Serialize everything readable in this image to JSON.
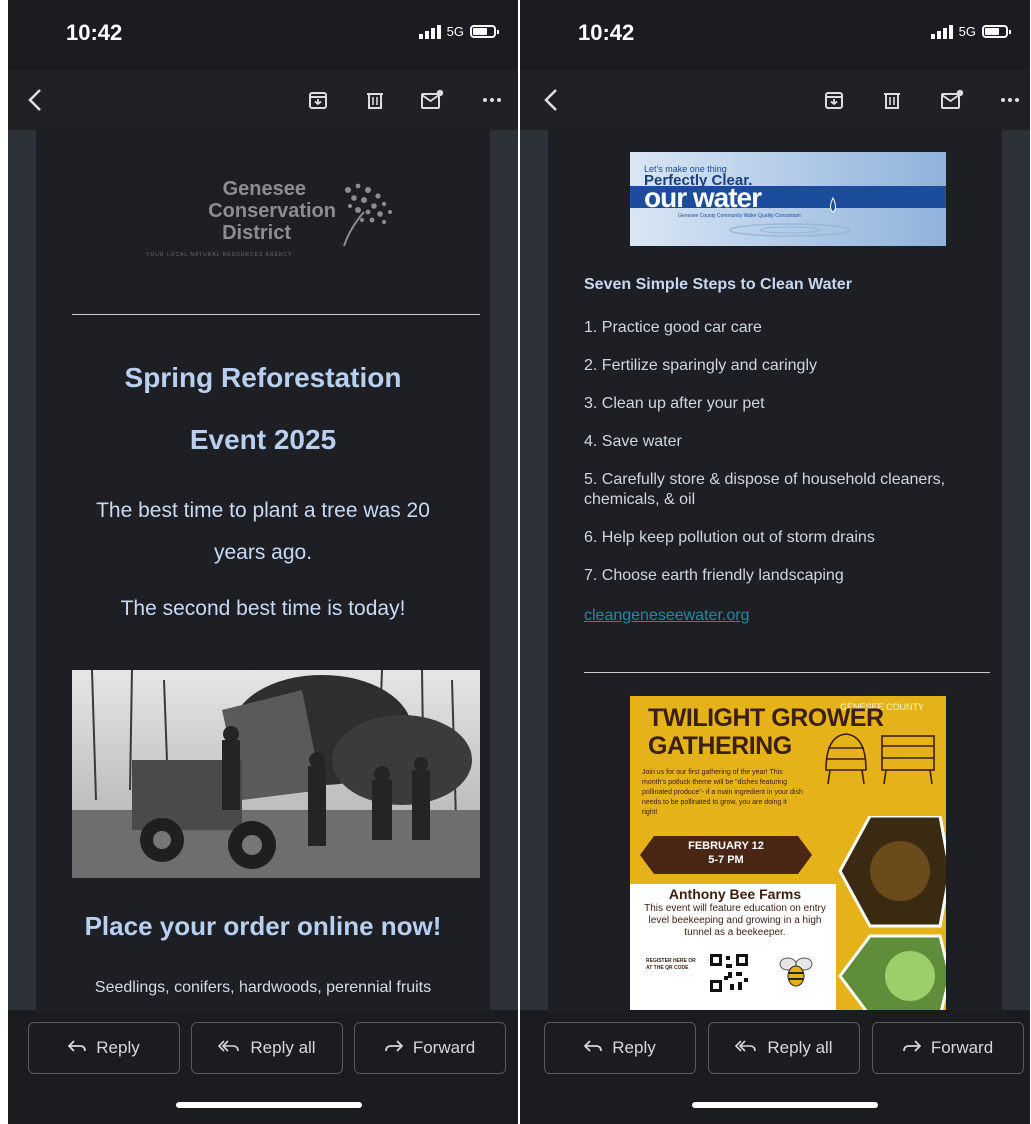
{
  "status_bar": {
    "time": "10:42",
    "network": "5G"
  },
  "actions": {
    "reply": "Reply",
    "reply_all": "Reply all",
    "forward": "Forward"
  },
  "left_email": {
    "logo_line1": "Genesee",
    "logo_line2": "Conservation",
    "logo_line3": "District",
    "logo_tagline": "YOUR LOCAL NATURAL RESOURCES AGENCY",
    "title_line1": "Spring Reforestation",
    "title_line2": "Event 2025",
    "quote_line1": "The best time to plant a tree was 20",
    "quote_line2": "years ago.",
    "quote_line3": "The second best time is today!",
    "order_heading": "Place your order online now!",
    "products": "Seedlings, conifers, hardwoods, perennial fruits"
  },
  "right_email": {
    "banner_small": "Let's make one thing",
    "banner_big": "Perfectly Clear.",
    "banner_word": "our water",
    "banner_caption": "Genesee County Community Water Quality Consortium",
    "steps_title": "Seven Simple Steps to Clean Water",
    "steps": [
      "1. Practice good car care",
      "2. Fertilize sparingly and caringly",
      "3. Clean up after your pet",
      "4. Save water",
      "5. Carefully store & dispose of household cleaners, chemicals, & oil",
      "6. Help keep pollution out of storm drains",
      "7. Choose earth friendly landscaping"
    ],
    "link_text": "cleangeneseewater.org ",
    "flyer": {
      "county": "GENESEE COUNTY",
      "title_line1": "TWILIGHT GROWER",
      "title_line2": "GATHERING",
      "intro": "Join us for our first gathering of the year! This month's potluck theme will be \"dishes featuring pollinated produce\"- if a main ingredient in your dish needs to be pollinated to grow, you are doing it right!",
      "date": "FEBRUARY 12",
      "time": "5-7 PM",
      "venue": "Anthony Bee Farms",
      "description": "This event will feature education on entry level beekeeping and growing in a high tunnel as a beekeeper.",
      "register": "REGISTER HERE OR AT THE QR CODE"
    }
  },
  "colors": {
    "background": "#1b1c20",
    "card": "#1e1f24",
    "title": "#b8cff0",
    "link": "#1f8aa4",
    "flyer": "#e5b219"
  }
}
